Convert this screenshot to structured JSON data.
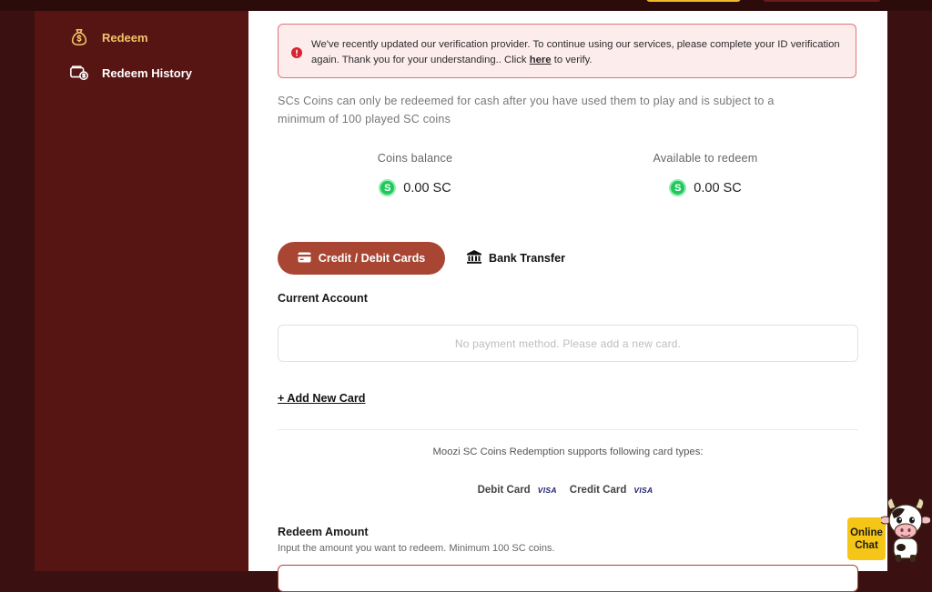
{
  "sidebar": {
    "items": [
      {
        "label": "Redeem",
        "icon": "money-bag-icon"
      },
      {
        "label": "Redeem History",
        "icon": "wallet-icon"
      }
    ]
  },
  "alert": {
    "text_before": "We've recently updated our verification provider. To continue using our services, please complete your ID verification again. Thank you for your understanding.. Click ",
    "link_label": "here",
    "text_after": " to verify."
  },
  "notice": "SCs Coins can only be redeemed for cash after you have used them to play and is subject to a minimum of 100 played SC coins",
  "balances": {
    "coins_balance_label": "Coins balance",
    "coins_balance_value": "0.00 SC",
    "available_label": "Available to redeem",
    "available_value": "0.00 SC",
    "coin_symbol": "S"
  },
  "tabs": {
    "cards_label": "Credit / Debit Cards",
    "bank_label": "Bank Transfer"
  },
  "account": {
    "title": "Current Account",
    "empty_text": "No payment method. Please add a new card.",
    "add_card_label": "+ Add New Card"
  },
  "card_support": {
    "text": "Moozi SC Coins Redemption supports following card types:",
    "types": [
      {
        "label": "Debit Card",
        "brand": "VISA"
      },
      {
        "label": "Credit Card",
        "brand": "VISA"
      }
    ]
  },
  "redeem_amount": {
    "title": "Redeem Amount",
    "subtitle": "Input the amount you want to redeem. Minimum 100 SC coins."
  },
  "chat": {
    "line1": "Online",
    "line2": "Chat"
  },
  "colors": {
    "accent": "#a84633",
    "sidebar_bg": "#561513",
    "page_bg": "#3a1110",
    "coin": "#22c55e",
    "chat_bg": "#f5c518"
  }
}
